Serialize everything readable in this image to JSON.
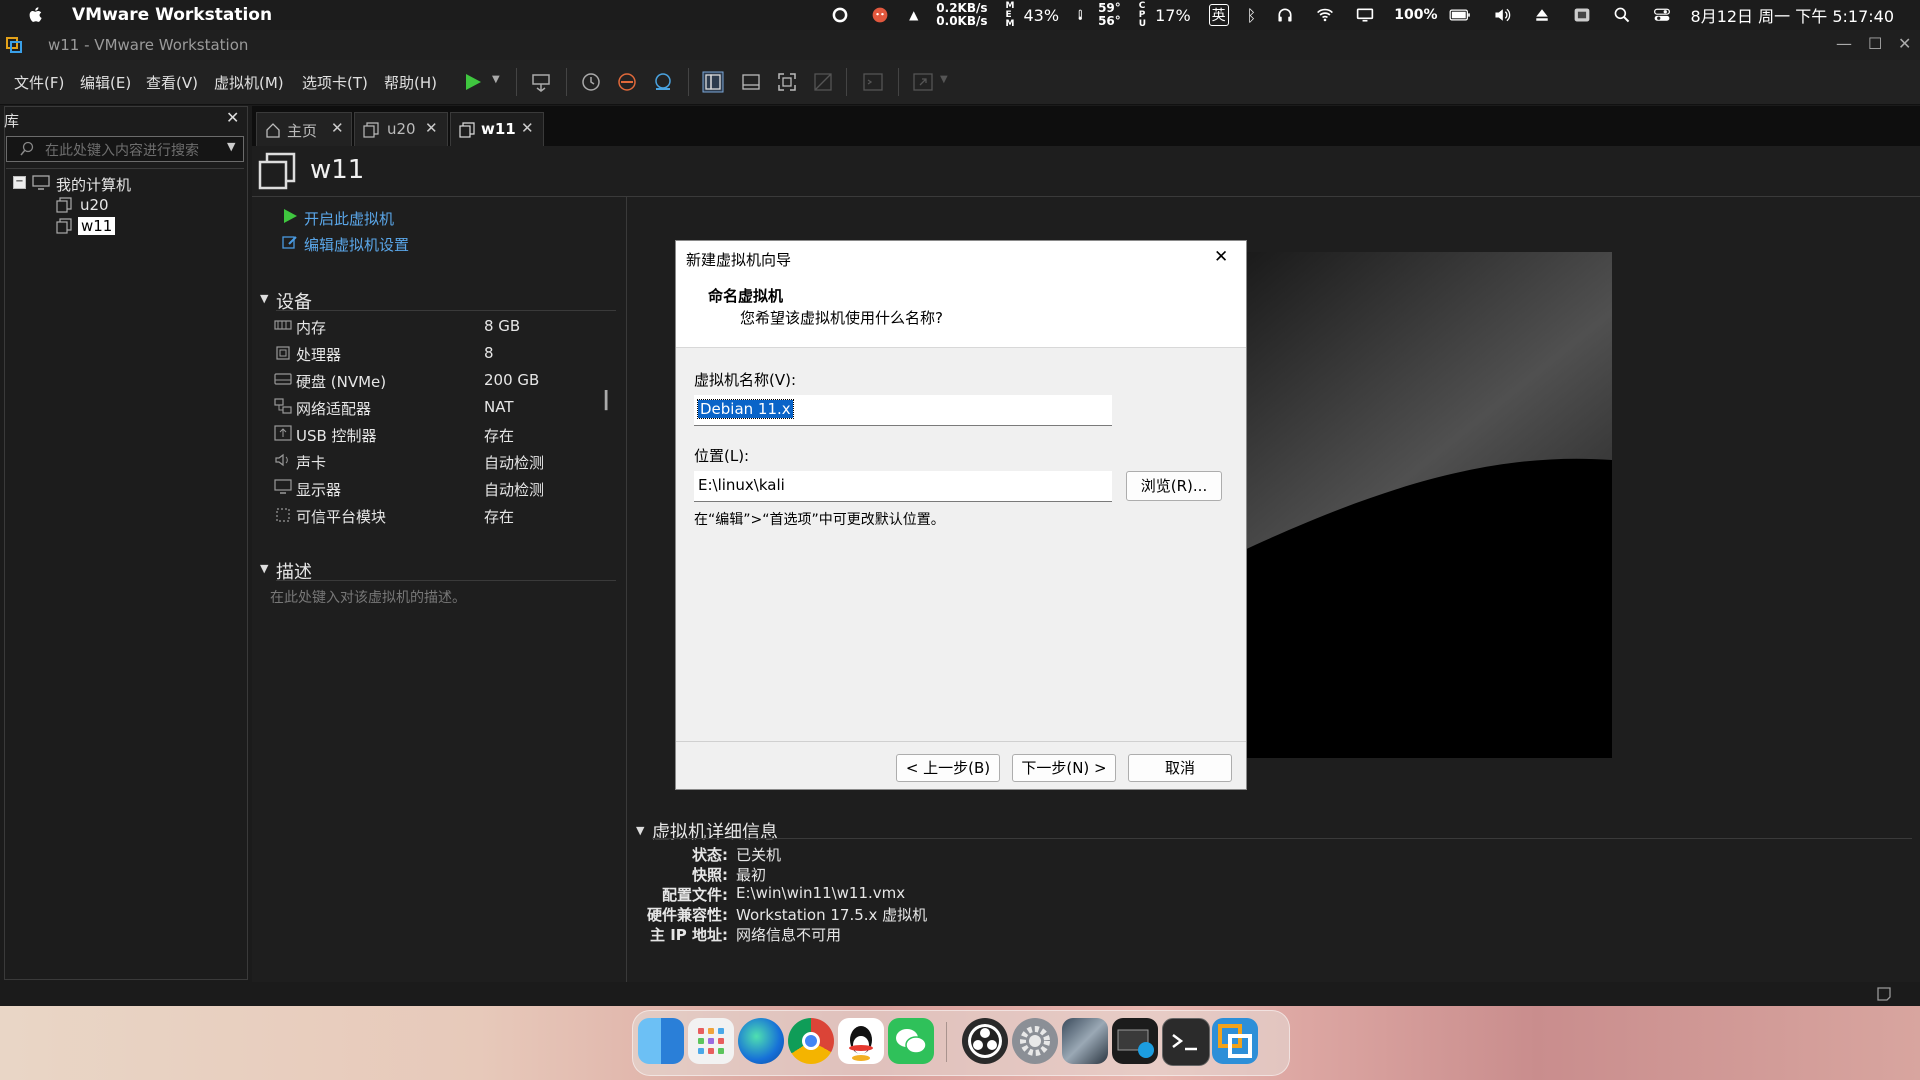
{
  "mac_menubar": {
    "app_name": "VMware Workstation",
    "net_up": "0.2KB/s",
    "net_down": "0.0KB/s",
    "mem_percent": "43%",
    "temp1": "59°",
    "temp2": "56°",
    "cpu_percent": "17%",
    "input_method": "英",
    "battery": "100%",
    "datetime": "8月12日 周一 下午 5:17:40"
  },
  "window": {
    "title": "w11 - VMware Workstation"
  },
  "menus": [
    "文件(F)",
    "编辑(E)",
    "查看(V)",
    "虚拟机(M)",
    "选项卡(T)",
    "帮助(H)"
  ],
  "library": {
    "title": "库",
    "search_placeholder": "在此处键入内容进行搜索",
    "root": "我的计算机",
    "vms": [
      "u20",
      "w11"
    ]
  },
  "tabs": [
    {
      "label": "主页"
    },
    {
      "label": "u20"
    },
    {
      "label": "w11"
    }
  ],
  "vm": {
    "name": "w11",
    "actions": {
      "power_on": "开启此虚拟机",
      "edit_settings": "编辑虚拟机设置"
    },
    "devices_title": "设备",
    "devices": [
      {
        "label": "内存",
        "value": "8 GB"
      },
      {
        "label": "处理器",
        "value": "8"
      },
      {
        "label": "硬盘 (NVMe)",
        "value": "200 GB"
      },
      {
        "label": "网络适配器",
        "value": "NAT"
      },
      {
        "label": "USB 控制器",
        "value": "存在"
      },
      {
        "label": "声卡",
        "value": "自动检测"
      },
      {
        "label": "显示器",
        "value": "自动检测"
      },
      {
        "label": "可信平台模块",
        "value": "存在"
      }
    ],
    "description_title": "描述",
    "description_placeholder": "在此处键入对该虚拟机的描述。",
    "details_title": "虚拟机详细信息",
    "details": [
      {
        "key": "状态:",
        "value": "已关机"
      },
      {
        "key": "快照:",
        "value": "最初"
      },
      {
        "key": "配置文件:",
        "value": "E:\\win\\win11\\w11.vmx"
      },
      {
        "key": "硬件兼容性:",
        "value": "Workstation 17.5.x 虚拟机"
      },
      {
        "key": "主 IP 地址:",
        "value": "网络信息不可用"
      }
    ]
  },
  "dialog": {
    "title": "新建虚拟机向导",
    "heading": "命名虚拟机",
    "subheading": "您希望该虚拟机使用什么名称?",
    "name_label": "虚拟机名称(V):",
    "name_value": "Debian 11.x",
    "location_label": "位置(L):",
    "location_value": "E:\\linux\\kali",
    "browse_button": "浏览(R)...",
    "hint": "在“编辑”>“首选项”中可更改默认位置。",
    "back_button": "< 上一步(B)",
    "next_button": "下一步(N) >",
    "cancel_button": "取消"
  },
  "dock_apps": [
    "finder",
    "launchpad",
    "edge",
    "chrome",
    "qq",
    "wechat",
    "obs",
    "settings",
    "photos",
    "remote-desktop",
    "terminal",
    "vmware"
  ]
}
